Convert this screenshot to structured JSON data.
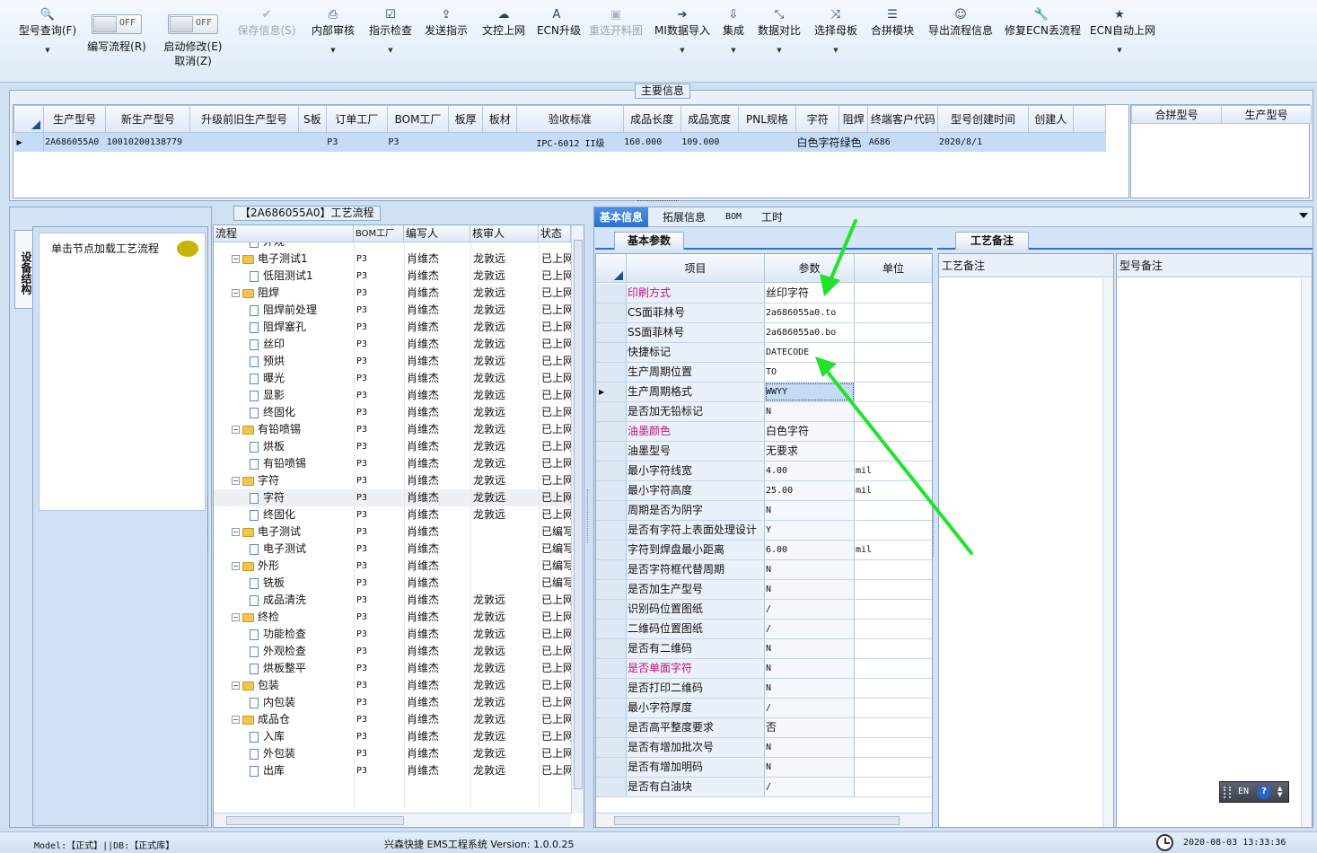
{
  "toolbar": {
    "items": [
      {
        "label": "型号查询(F)",
        "icon": "search-icon",
        "dropdown": true
      },
      {
        "label": "编写流程(R)",
        "toggle": "OFF"
      },
      {
        "label": "启动修改(E)",
        "label2": "取消(Z)",
        "toggle": "OFF"
      },
      {
        "label": "保存信息(S)",
        "icon": "check-icon",
        "disabled": true
      },
      {
        "label": "内部审核",
        "icon": "print-icon",
        "dropdown": true
      },
      {
        "label": "指示检查",
        "icon": "checkbox-icon",
        "dropdown": true
      },
      {
        "label": "发送指示",
        "icon": "upload-icon"
      },
      {
        "label": "文控上网",
        "icon": "cloud-upload-icon"
      },
      {
        "label": "ECN升级",
        "icon": "font-icon"
      },
      {
        "label": "重选开料图",
        "icon": "image-icon",
        "disabled": true
      },
      {
        "label": "MI数据导入",
        "icon": "sign-in-icon",
        "dropdown": true
      },
      {
        "label": "集成",
        "icon": "download-icon",
        "dropdown": true
      },
      {
        "label": "数据对比",
        "icon": "compress-icon",
        "dropdown": true
      },
      {
        "label": "选择母板",
        "icon": "shuffle-icon",
        "dropdown": true
      },
      {
        "label": "合拼模块",
        "icon": "list-icon"
      },
      {
        "label": "导出流程信息",
        "icon": "smile-icon"
      },
      {
        "label": "修复ECN丢流程",
        "icon": "wrench-icon"
      },
      {
        "label": "ECN自动上网",
        "icon": "star-icon",
        "dropdown": true
      }
    ]
  },
  "main_info": {
    "title": "主要信息",
    "columns": [
      "生产型号",
      "新生产型号",
      "升级前旧生产型号",
      "S板",
      "订单工厂",
      "BOM工厂",
      "板厚",
      "板材",
      "验收标准",
      "成品长度",
      "成品宽度",
      "PNL规格",
      "字符",
      "阻焊",
      "终端客户代码",
      "型号创建时间",
      "创建人"
    ],
    "row": [
      "2A686055A0",
      "10010200138779",
      "",
      "",
      "P3",
      "P3",
      "",
      "",
      "IPC-6012 II级",
      "160.000",
      "109.000",
      "",
      "白色字符",
      "绿色",
      "A686",
      "2020/8/1",
      ""
    ],
    "side_columns": [
      "合拼型号",
      "生产型号"
    ]
  },
  "left_panel": {
    "vertical_tab": "设备结构",
    "hint": "单击节点加载工艺流程"
  },
  "process": {
    "title": "【2A686055A0】工艺流程",
    "columns": [
      "流程",
      "BOM工厂",
      "编写人",
      "核审人",
      "状态"
    ],
    "rows": [
      {
        "name": "外观",
        "level": 2,
        "bom": "",
        "writer": "",
        "reviewer": "",
        "status": "",
        "partial": true
      },
      {
        "name": "电子测试1",
        "level": 1,
        "bom": "P3",
        "writer": "肖维杰",
        "reviewer": "龙敦远",
        "status": "已上网"
      },
      {
        "name": "低阻测试1",
        "level": 2,
        "bom": "P3",
        "writer": "肖维杰",
        "reviewer": "龙敦远",
        "status": "已上网"
      },
      {
        "name": "阻焊",
        "level": 1,
        "bom": "P3",
        "writer": "肖维杰",
        "reviewer": "龙敦远",
        "status": "已上网"
      },
      {
        "name": "阻焊前处理",
        "level": 2,
        "bom": "P3",
        "writer": "肖维杰",
        "reviewer": "龙敦远",
        "status": "已上网"
      },
      {
        "name": "阻焊塞孔",
        "level": 2,
        "bom": "P3",
        "writer": "肖维杰",
        "reviewer": "龙敦远",
        "status": "已上网"
      },
      {
        "name": "丝印",
        "level": 2,
        "bom": "P3",
        "writer": "肖维杰",
        "reviewer": "龙敦远",
        "status": "已上网"
      },
      {
        "name": "预烘",
        "level": 2,
        "bom": "P3",
        "writer": "肖维杰",
        "reviewer": "龙敦远",
        "status": "已上网"
      },
      {
        "name": "曝光",
        "level": 2,
        "bom": "P3",
        "writer": "肖维杰",
        "reviewer": "龙敦远",
        "status": "已上网"
      },
      {
        "name": "显影",
        "level": 2,
        "bom": "P3",
        "writer": "肖维杰",
        "reviewer": "龙敦远",
        "status": "已上网"
      },
      {
        "name": "终固化",
        "level": 2,
        "bom": "P3",
        "writer": "肖维杰",
        "reviewer": "龙敦远",
        "status": "已上网"
      },
      {
        "name": "有铅喷锡",
        "level": 1,
        "bom": "P3",
        "writer": "肖维杰",
        "reviewer": "龙敦远",
        "status": "已上网"
      },
      {
        "name": "烘板",
        "level": 2,
        "bom": "P3",
        "writer": "肖维杰",
        "reviewer": "龙敦远",
        "status": "已上网"
      },
      {
        "name": "有铅喷锡",
        "level": 2,
        "bom": "P3",
        "writer": "肖维杰",
        "reviewer": "龙敦远",
        "status": "已上网"
      },
      {
        "name": "字符",
        "level": 1,
        "bom": "P3",
        "writer": "肖维杰",
        "reviewer": "龙敦远",
        "status": "已上网"
      },
      {
        "name": "字符",
        "level": 2,
        "bom": "P3",
        "writer": "肖维杰",
        "reviewer": "龙敦远",
        "status": "已上网",
        "selected": true
      },
      {
        "name": "终固化",
        "level": 2,
        "bom": "P3",
        "writer": "肖维杰",
        "reviewer": "龙敦远",
        "status": "已上网"
      },
      {
        "name": "电子测试",
        "level": 1,
        "bom": "P3",
        "writer": "肖维杰",
        "reviewer": "",
        "status": "已编写"
      },
      {
        "name": "电子测试",
        "level": 2,
        "bom": "P3",
        "writer": "肖维杰",
        "reviewer": "",
        "status": "已编写"
      },
      {
        "name": "外形",
        "level": 1,
        "bom": "P3",
        "writer": "肖维杰",
        "reviewer": "",
        "status": "已编写"
      },
      {
        "name": "铣板",
        "level": 2,
        "bom": "P3",
        "writer": "肖维杰",
        "reviewer": "",
        "status": "已编写"
      },
      {
        "name": "成品清洗",
        "level": 2,
        "bom": "P3",
        "writer": "肖维杰",
        "reviewer": "龙敦远",
        "status": "已上网"
      },
      {
        "name": "终检",
        "level": 1,
        "bom": "P3",
        "writer": "肖维杰",
        "reviewer": "龙敦远",
        "status": "已上网"
      },
      {
        "name": "功能检查",
        "level": 2,
        "bom": "P3",
        "writer": "肖维杰",
        "reviewer": "龙敦远",
        "status": "已上网"
      },
      {
        "name": "外观检查",
        "level": 2,
        "bom": "P3",
        "writer": "肖维杰",
        "reviewer": "龙敦远",
        "status": "已上网"
      },
      {
        "name": "烘板整平",
        "level": 2,
        "bom": "P3",
        "writer": "肖维杰",
        "reviewer": "龙敦远",
        "status": "已上网"
      },
      {
        "name": "包装",
        "level": 1,
        "bom": "P3",
        "writer": "肖维杰",
        "reviewer": "龙敦远",
        "status": "已上网"
      },
      {
        "name": "内包装",
        "level": 2,
        "bom": "P3",
        "writer": "肖维杰",
        "reviewer": "龙敦远",
        "status": "已上网"
      },
      {
        "name": "成品仓",
        "level": 1,
        "bom": "P3",
        "writer": "肖维杰",
        "reviewer": "龙敦远",
        "status": "已上网"
      },
      {
        "name": "入库",
        "level": 2,
        "bom": "P3",
        "writer": "肖维杰",
        "reviewer": "龙敦远",
        "status": "已上网"
      },
      {
        "name": "外包装",
        "level": 2,
        "bom": "P3",
        "writer": "肖维杰",
        "reviewer": "龙敦远",
        "status": "已上网"
      },
      {
        "name": "出库",
        "level": 2,
        "bom": "P3",
        "writer": "肖维杰",
        "reviewer": "龙敦远",
        "status": "已上网"
      }
    ]
  },
  "detail": {
    "tabs": [
      "基本信息",
      "拓展信息",
      "BOM",
      "工时"
    ],
    "subtab": "基本参数",
    "columns": [
      "项目",
      "参数",
      "单位"
    ],
    "rows": [
      {
        "item": "印刷方式",
        "param": "丝印字符",
        "unit": "",
        "pink": true
      },
      {
        "item": "CS面菲林号",
        "param": "2a686055a0.to",
        "unit": "",
        "mono": true
      },
      {
        "item": "SS面菲林号",
        "param": "2a686055a0.bo",
        "unit": "",
        "mono": true
      },
      {
        "item": "快捷标记",
        "param": "DATECODE",
        "unit": "",
        "mono": true
      },
      {
        "item": "生产周期位置",
        "param": "TO",
        "unit": "",
        "mono": true
      },
      {
        "item": "生产周期格式",
        "param": "WWYY",
        "unit": "",
        "mono": true,
        "current": true
      },
      {
        "item": "是否加无铅标记",
        "param": "N",
        "unit": "",
        "mono": true
      },
      {
        "item": "油墨颜色",
        "param": "白色字符",
        "unit": "",
        "pink": true
      },
      {
        "item": "油墨型号",
        "param": "无要求",
        "unit": ""
      },
      {
        "item": "最小字符线宽",
        "param": "4.00",
        "unit": "mil",
        "mono": true
      },
      {
        "item": "最小字符高度",
        "param": "25.00",
        "unit": "mil",
        "mono": true
      },
      {
        "item": "周期是否为阴字",
        "param": "N",
        "unit": "",
        "mono": true
      },
      {
        "item": "是否有字符上表面处理设计",
        "param": "Y",
        "unit": "",
        "mono": true
      },
      {
        "item": "字符到焊盘最小距离",
        "param": "6.00",
        "unit": "mil",
        "mono": true
      },
      {
        "item": "是否字符框代替周期",
        "param": "N",
        "unit": "",
        "mono": true
      },
      {
        "item": "是否加生产型号",
        "param": "N",
        "unit": "",
        "mono": true
      },
      {
        "item": "识别码位置图纸",
        "param": "/",
        "unit": "",
        "mono": true
      },
      {
        "item": "二维码位置图纸",
        "param": "/",
        "unit": "",
        "mono": true
      },
      {
        "item": "是否有二维码",
        "param": "N",
        "unit": "",
        "mono": true
      },
      {
        "item": "是否单面字符",
        "param": "N",
        "unit": "",
        "mono": true,
        "pink": true
      },
      {
        "item": "是否打印二维码",
        "param": "N",
        "unit": "",
        "mono": true
      },
      {
        "item": "最小字符厚度",
        "param": "/",
        "unit": "",
        "mono": true
      },
      {
        "item": "是否高平整度要求",
        "param": "否",
        "unit": ""
      },
      {
        "item": "是否有增加批次号",
        "param": "N",
        "unit": "",
        "mono": true
      },
      {
        "item": "是否有增加明码",
        "param": "N",
        "unit": "",
        "mono": true
      },
      {
        "item": "是否有白油块",
        "param": "/",
        "unit": "",
        "mono": true
      }
    ]
  },
  "notes": {
    "tab": "工艺备注",
    "col1": "工艺备注",
    "col2": "型号备注"
  },
  "ime": {
    "lang": "EN",
    "help": "?"
  },
  "status_bar": {
    "left": "Model:【正式】||DB:【正式库】",
    "center": "兴森快捷 EMS工程系统 Version: 1.0.0.25",
    "time": "2020-08-03 13:33:36"
  },
  "colors": {
    "accent": "#2d6fcf",
    "pink": "#c0147a",
    "arrow": "#22e22b",
    "selected_row": "#c5dcf7"
  }
}
